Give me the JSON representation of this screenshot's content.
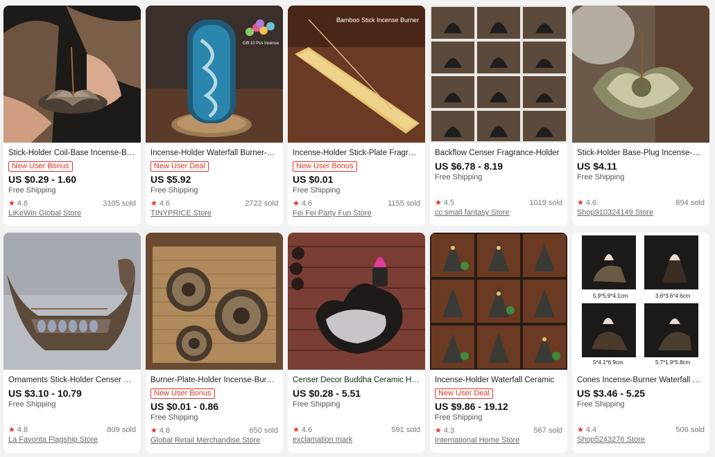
{
  "products": [
    {
      "title": "Stick-Holder Coil-Base Incense-Burner",
      "badge": "New User Bonus",
      "price": "US $0.29 - 1.60",
      "shipping": "Free Shipping",
      "rating": "4.8",
      "sold": "3105 sold",
      "store": "LiKeWin Global Store",
      "image": "lotus-hand-icon"
    },
    {
      "title": "Incense-Holder Waterfall Burner-Silicone",
      "badge": "New User Deal",
      "price": "US $5.92",
      "shipping": "Free Shipping",
      "rating": "4.6",
      "sold": "2722 sold",
      "store": "TINYPRICE Store",
      "image": "waterfall-burner-icon",
      "overlay": "Gift 10 Pcs Incense"
    },
    {
      "title": "Incense-Holder Stick-Plate Fragrance",
      "badge": "New User Bonus",
      "price": "US $0.01",
      "shipping": "Free Shipping",
      "rating": "4.6",
      "sold": "1155 sold",
      "store": "Fei Fei Party Fun Store",
      "image": "bamboo-stick-icon",
      "overlay": "Bamboo Stick Incense Burner"
    },
    {
      "title": "Backflow Censer Fragrance-Holder",
      "badge": "",
      "price": "US $6.78 - 8.19",
      "shipping": "Free Shipping",
      "rating": "4.5",
      "sold": "1019 sold",
      "store": "cc small fantasy Store",
      "image": "backflow-grid-icon"
    },
    {
      "title": "Stick-Holder Base-Plug Incense-Burner",
      "badge": "",
      "price": "US $4.11",
      "shipping": "Free Shipping",
      "rating": "4.6",
      "sold": "894 sold",
      "store": "Shop910324149 Store",
      "image": "ceramic-lotus-icon"
    },
    {
      "title": "Ornaments Stick-Holder Censer Boat",
      "badge": "",
      "price": "US $3.10 - 10.79",
      "shipping": "Free Shipping",
      "rating": "4.8",
      "sold": "809 sold",
      "store": "La Favorita Flagship Store",
      "image": "dragon-boat-icon"
    },
    {
      "title": "Burner-Plate-Holder Incense-Burner",
      "badge": "New User Bonus",
      "price": "US $0.01 - 0.86",
      "shipping": "Free Shipping",
      "rating": "4.8",
      "sold": "650 sold",
      "store": "Global Retail Merchandise Store",
      "image": "lotus-plates-icon"
    },
    {
      "title": "Censer Decor Buddha Ceramic Holder",
      "badge": "",
      "price": "US $0.28 - 5.51",
      "shipping": "Free Shipping",
      "rating": "4.6",
      "sold": "591 sold",
      "store": "exclamation mark",
      "image": "smoke-cone-icon"
    },
    {
      "title": "Incense-Holder Waterfall Ceramic",
      "badge": "New User Deal",
      "price": "US $9.86 - 19.12",
      "shipping": "Free Shipping",
      "rating": "4.3",
      "sold": "567 sold",
      "store": "International Home Store",
      "image": "waterfall-grid-icon"
    },
    {
      "title": "Cones Incense-Burner Waterfall Backflow",
      "badge": "",
      "price": "US $3.46 - 5.25",
      "shipping": "Free Shipping",
      "rating": "4.4",
      "sold": "506 sold",
      "store": "Shop5243276 Store",
      "image": "cones-burner-icon",
      "captions": [
        "5.9*5.9*4.1cm",
        "3.6*3.6*4.6cm",
        "5*4.1*6.9cm",
        "5.7*1.9*5.8cm"
      ]
    }
  ],
  "colors": {
    "accent": "#e43225",
    "background": "#f2f2f2",
    "card": "#ffffff"
  }
}
